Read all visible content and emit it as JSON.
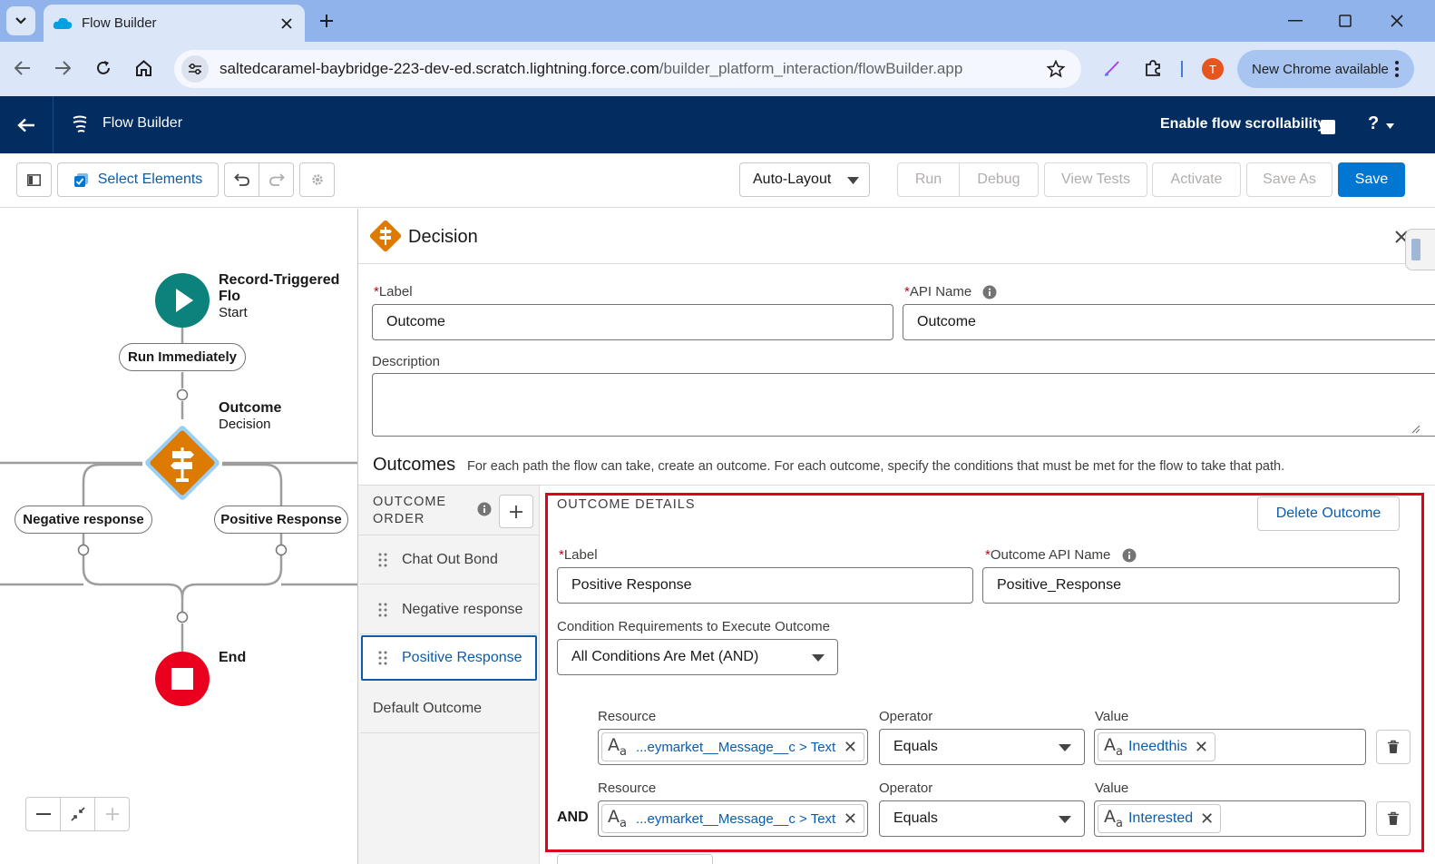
{
  "browser": {
    "tab_title": "Flow Builder",
    "url_host": "saltedcaramel-baybridge-223-dev-ed.scratch.lightning.force.com",
    "url_path": "/builder_platform_interaction/flowBuilder.app",
    "profile_initial": "T",
    "new_chrome_label": "New Chrome available"
  },
  "header": {
    "app_name": "Flow Builder",
    "scroll_label": "Enable flow scrollability",
    "help": "?"
  },
  "toolbar": {
    "select_elements": "Select Elements",
    "layout_select": "Auto-Layout",
    "run": "Run",
    "debug": "Debug",
    "view_tests": "View Tests",
    "activate": "Activate",
    "save_as": "Save As",
    "save": "Save"
  },
  "canvas": {
    "start_title": "Record-Triggered Flo",
    "start_subtitle": "Start",
    "run_immediately": "Run Immediately",
    "decision_title": "Outcome",
    "decision_subtitle": "Decision",
    "branch_left": "Negative response",
    "branch_right": "Positive Response",
    "end_label": "End"
  },
  "panel": {
    "title": "Decision",
    "label_label": "Label",
    "label_value": "Outcome",
    "api_label": "API Name",
    "api_value": "Outcome",
    "description_label": "Description",
    "description_value": "",
    "outcomes_heading": "Outcomes",
    "outcomes_help": "For each path the flow can take, create an outcome. For each outcome, specify the conditions that must be met for the flow to take that path.",
    "order_heading_1": "OUTCOME",
    "order_heading_2": "ORDER",
    "order_items": [
      "Chat Out Bond",
      "Negative response",
      "Positive Response",
      "Default Outcome"
    ],
    "details_heading": "OUTCOME DETAILS",
    "delete_outcome": "Delete Outcome",
    "detail_label_label": "Label",
    "detail_label_value": "Positive Response",
    "detail_api_label": "Outcome API Name",
    "detail_api_value": "Positive_Response",
    "condition_req_label": "Condition Requirements to Execute Outcome",
    "condition_req_value": "All Conditions Are Met (AND)",
    "conditions": [
      {
        "prefix": "",
        "resource_label": "Resource",
        "resource": "...eymarket__Message__c > Text",
        "operator_label": "Operator",
        "operator": "Equals",
        "value_label": "Value",
        "value": "Ineedthis"
      },
      {
        "prefix": "AND",
        "resource_label": "Resource",
        "resource": "...eymarket__Message__c > Text",
        "operator_label": "Operator",
        "operator": "Equals",
        "value_label": "Value",
        "value": "Interested"
      }
    ]
  },
  "colors": {
    "brand_blue": "#0176d3",
    "header_navy": "#032d60",
    "decision_orange": "#dd7a01",
    "start_teal": "#0b827c",
    "end_red": "#ea001e",
    "highlight_red": "#e0001b"
  }
}
